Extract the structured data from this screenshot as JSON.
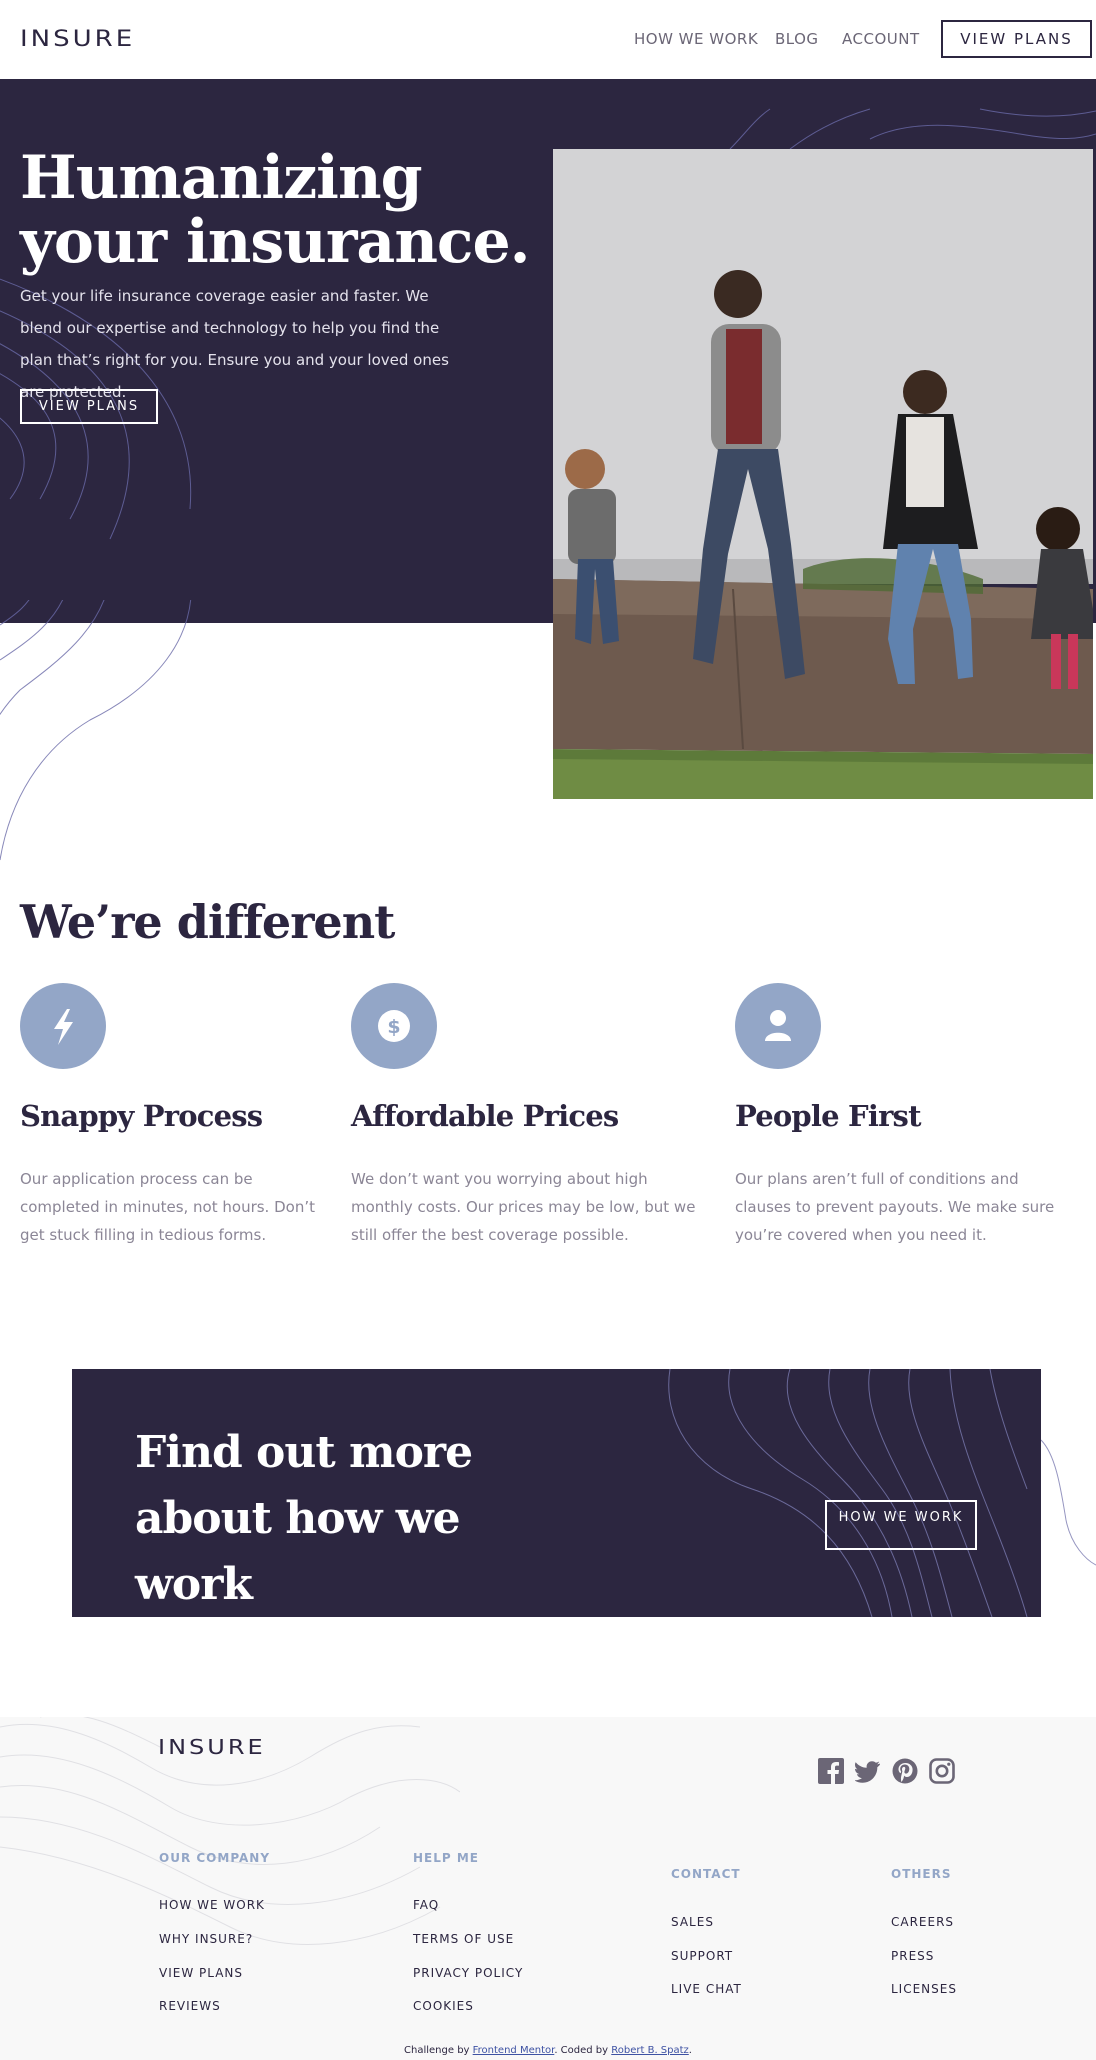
{
  "nav": {
    "logo": "INSURE",
    "links": [
      "HOW WE WORK",
      "BLOG",
      "ACCOUNT"
    ],
    "cta": "VIEW PLANS"
  },
  "hero": {
    "title": "Humanizing your insurance.",
    "text": "Get your life insurance coverage easier and faster. We blend our expertise and technology to help you find the plan that’s right for you. Ensure you and your loved ones are protected.",
    "button": "VIEW PLANS"
  },
  "different": {
    "title": "We’re different",
    "features": [
      {
        "icon": "lightning-icon",
        "title": "Snappy Process",
        "text": "Our application process can be completed in minutes, not hours. Don’t get stuck filling in tedious forms."
      },
      {
        "icon": "dollar-icon",
        "title": "Affordable Prices",
        "text": "We don’t want you worrying about high monthly costs. Our prices may be low, but we still offer the best coverage possible."
      },
      {
        "icon": "person-icon",
        "title": "People First",
        "text": "Our plans aren’t full of conditions and clauses to prevent payouts. We make sure you’re covered when you need it."
      }
    ]
  },
  "cta": {
    "title": "Find out more about how we work",
    "button": "HOW WE WORK"
  },
  "footer": {
    "logo": "INSURE",
    "social": [
      "facebook-icon",
      "twitter-icon",
      "pinterest-icon",
      "instagram-icon"
    ],
    "columns": [
      {
        "heading": "OUR COMPANY",
        "links": [
          "HOW WE WORK",
          "WHY INSURE?",
          "VIEW PLANS",
          "REVIEWS"
        ]
      },
      {
        "heading": "HELP ME",
        "links": [
          "FAQ",
          "TERMS OF USE",
          "PRIVACY POLICY",
          "COOKIES"
        ]
      },
      {
        "heading": "CONTACT",
        "links": [
          "SALES",
          "SUPPORT",
          "LIVE CHAT"
        ]
      },
      {
        "heading": "OTHERS",
        "links": [
          "CAREERS",
          "PRESS",
          "LICENSES"
        ]
      }
    ],
    "attribution": {
      "prefix": "Challenge by ",
      "link1": "Frontend Mentor",
      "middle": ". Coded by ",
      "link2": "Robert B. Spatz",
      "suffix": "."
    }
  },
  "colors": {
    "dark_violet": "#2c2640",
    "grayish_blue": "#93a6c7",
    "white": "#ffffff",
    "footer_bg": "#f8f8f8"
  }
}
